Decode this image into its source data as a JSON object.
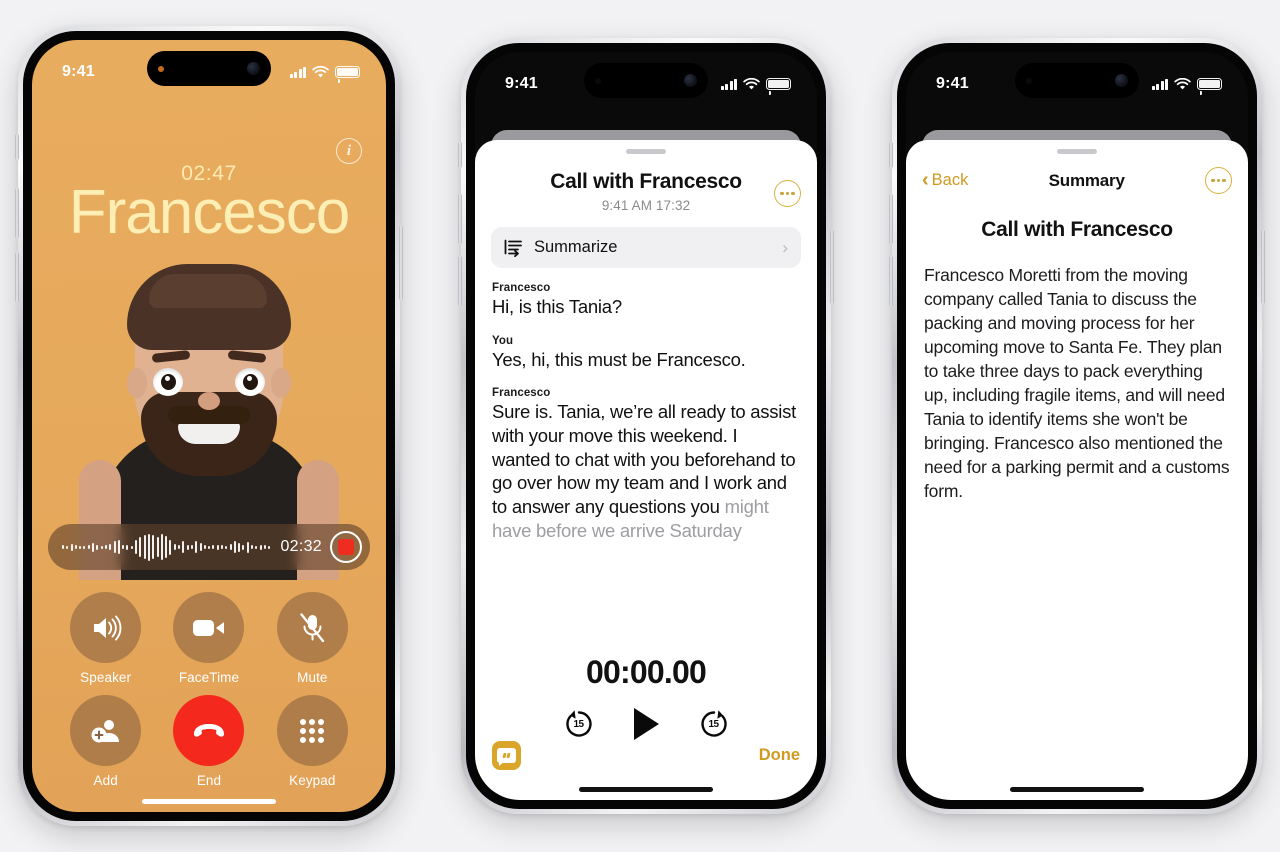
{
  "phone1": {
    "status": {
      "time": "9:41",
      "signal_icon": "cellular-bars-icon",
      "wifi_icon": "wifi-icon",
      "battery_icon": "battery-icon"
    },
    "info_icon": "info-icon",
    "call_duration": "02:47",
    "contact_name": "Francesco",
    "recording": {
      "time": "02:32",
      "waveform_icon": "audio-waveform-icon",
      "record_button_icon": "record-stop-icon"
    },
    "controls": [
      {
        "label": "Speaker",
        "icon": "speaker-icon"
      },
      {
        "label": "FaceTime",
        "icon": "video-camera-icon"
      },
      {
        "label": "Mute",
        "icon": "microphone-muted-icon"
      },
      {
        "label": "Add",
        "icon": "add-person-icon"
      },
      {
        "label": "End",
        "icon": "end-call-icon"
      },
      {
        "label": "Keypad",
        "icon": "keypad-icon"
      }
    ],
    "colors": {
      "background": "#e8ac5f",
      "name_text": "#fdeeb4",
      "end_button": "#f4281c",
      "record_dot": "#ee2d20"
    }
  },
  "phone2": {
    "status": {
      "time": "9:41",
      "signal_icon": "cellular-bars-icon",
      "wifi_icon": "wifi-icon",
      "battery_icon": "battery-icon"
    },
    "title": "Call with Francesco",
    "subtitle": "9:41 AM  17:32",
    "more_icon": "more-options-icon",
    "summarize": {
      "label": "Summarize",
      "icon": "summarize-icon",
      "chevron": "›"
    },
    "transcript": [
      {
        "speaker": "Francesco",
        "text": "Hi, is this Tania?"
      },
      {
        "speaker": "You",
        "text": "Yes, hi, this must be Francesco."
      },
      {
        "speaker": "Francesco",
        "text": "Sure is. Tania, we’re all ready to assist with your move this weekend. I wanted to chat with you beforehand to go over how my team and I work and to answer any questions you ",
        "text_dim": "might have before we arrive Saturday"
      }
    ],
    "player": {
      "time": "00:00.00",
      "skip_back_label": "15",
      "skip_forward_label": "15",
      "play_icon": "play-icon",
      "skip_back_icon": "skip-back-15-icon",
      "skip_forward_icon": "skip-forward-15-icon"
    },
    "footer": {
      "transcript_icon": "transcript-quote-icon",
      "done_label": "Done"
    },
    "colors": {
      "accent": "#cf9b21",
      "row_background": "#f0f0f2"
    }
  },
  "phone3": {
    "status": {
      "time": "9:41",
      "signal_icon": "cellular-bars-icon",
      "wifi_icon": "wifi-icon",
      "battery_icon": "battery-icon"
    },
    "back_label": "Back",
    "back_icon": "chevron-left-icon",
    "nav_title": "Summary",
    "more_icon": "more-options-icon",
    "heading": "Call with Francesco",
    "summary_text": "Francesco Moretti from the moving company called Tania to discuss the packing and moving process for her upcoming move to Santa Fe. They plan to take three days to pack everything up, including fragile items, and will need Tania to identify items she won't be bringing. Francesco also mentioned the need for a parking permit and a customs form.",
    "colors": {
      "accent": "#cf9b21"
    }
  }
}
